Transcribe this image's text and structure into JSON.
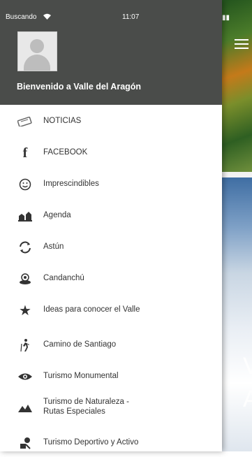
{
  "status": {
    "carrier": "Buscando",
    "time": "11:07"
  },
  "header": {
    "welcome": "Bienvenido a Valle del Aragón"
  },
  "menu": {
    "items": [
      {
        "label": "NOTICIAS",
        "icon": "news-icon"
      },
      {
        "label": "FACEBOOK",
        "icon": "facebook-icon"
      },
      {
        "label": "Imprescindibles",
        "icon": "smiley-icon"
      },
      {
        "label": "Agenda",
        "icon": "agenda-icon"
      },
      {
        "label": "Astún",
        "icon": "ski-lift-icon"
      },
      {
        "label": "Candanchú",
        "icon": "location-icon"
      },
      {
        "label": "Ideas para conocer el Valle",
        "icon": "star-icon"
      },
      {
        "label": "Camino de Santiago",
        "icon": "hiker-icon"
      },
      {
        "label": "Turismo Monumental",
        "icon": "eye-icon"
      },
      {
        "label": "Turismo de Naturaleza -",
        "label2": "Rutas Especiales",
        "icon": "mountain-icon"
      },
      {
        "label": "Turismo Deportivo y Activo",
        "icon": "sport-icon"
      }
    ]
  },
  "background": {
    "text_line1": "V",
    "text_line2": "A"
  }
}
